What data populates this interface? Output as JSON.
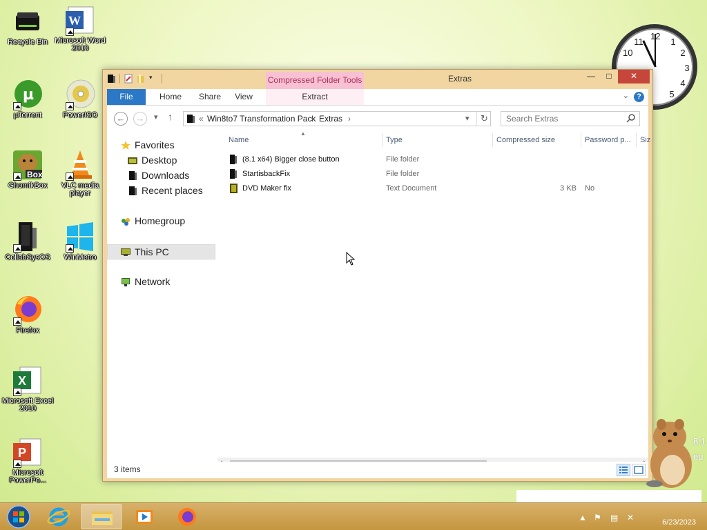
{
  "desktop": {
    "icons": [
      {
        "label": "Recycle Bin"
      },
      {
        "label": "Microsoft Word 2010"
      },
      {
        "label": "µTorrent"
      },
      {
        "label": "PowerISO"
      },
      {
        "label": "GhomikBox"
      },
      {
        "label": "VLC media player"
      },
      {
        "label": "CollabSysOS"
      },
      {
        "label": "WinMetro"
      },
      {
        "label": "Firefox"
      },
      {
        "label": "Microsoft Excel 2010"
      },
      {
        "label": "Microsoft PowerPo..."
      }
    ],
    "box_badge": "Box"
  },
  "clock": {
    "numbers": [
      "12",
      "1",
      "2",
      "3",
      "4",
      "5",
      "10",
      "11"
    ]
  },
  "window": {
    "title": "Extras",
    "context_tab_group": "Compressed Folder Tools",
    "tabs": {
      "file": "File",
      "home": "Home",
      "share": "Share",
      "view": "View",
      "extract": "Extract"
    },
    "help": "?",
    "caption": {
      "minimize": "—",
      "maximize": "□",
      "close": "✕"
    },
    "address": {
      "overflow": "«",
      "crumbs": [
        "Win8to7 Transformation Pack",
        "Extras"
      ],
      "separator": "›"
    },
    "search": {
      "placeholder": "Search Extras"
    },
    "nav": {
      "favorites": "Favorites",
      "desktop": "Desktop",
      "downloads": "Downloads",
      "recent": "Recent places",
      "homegroup": "Homegroup",
      "this_pc": "This PC",
      "network": "Network"
    },
    "columns": {
      "name": "Name",
      "type": "Type",
      "compressed_size": "Compressed size",
      "password": "Password p...",
      "size": "Siz"
    },
    "files": [
      {
        "name": "(8.1 x64) Bigger close button",
        "type": "File folder",
        "size": "",
        "password": ""
      },
      {
        "name": "StartisbackFix",
        "type": "File folder",
        "size": "",
        "password": ""
      },
      {
        "name": "DVD Maker fix",
        "type": "Text Document",
        "size": "3 KB",
        "password": "No"
      }
    ],
    "status": "3 items"
  },
  "taskbar": {
    "date": "6/23/2023"
  },
  "watermark": {
    "line1": "8.1",
    "line2": "eu"
  }
}
